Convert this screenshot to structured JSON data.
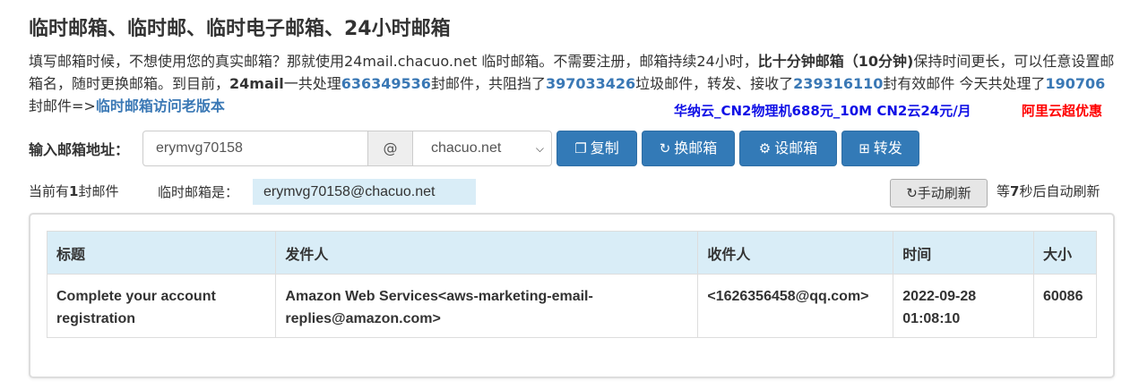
{
  "page_title": "临时邮箱、临时邮、临时电子邮箱、24小时邮箱",
  "intro": {
    "p1": "填写邮箱时候，不想使用您的真实邮箱？那就使用24mail.chacuo.net 临时邮箱。不需要注册，邮箱持续24小时，",
    "bold1": "比十分钟邮箱（10分钟)",
    "p2": "保持时间更长，可以任意设置邮箱名，随时更换邮箱。到目前，",
    "bold2": "24mail",
    "p3": "一共处理",
    "n1": "636349536",
    "p4": "封邮件，共阻挡了",
    "n2": "397033426",
    "p5": "垃圾邮件，转发、接收了",
    "n3": "239316110",
    "p6": "封有效邮件 今天共处理了",
    "n4": "190706",
    "p7": "封邮件=>",
    "old_link": "临时邮箱访问老版本"
  },
  "ads": {
    "ad1": "华纳云_CN2物理机688元_10M CN2云24元/月",
    "ad2": "阿里云超优惠"
  },
  "form": {
    "label": "输入邮箱地址：",
    "mailbox_value": "erymvg70158",
    "at": "@",
    "domain_selected": "chacuo.net",
    "buttons": {
      "copy": "复制",
      "change": "换邮箱",
      "set": "设邮箱",
      "forward": "转发"
    }
  },
  "status": {
    "count_prefix": "当前有",
    "count": "1",
    "count_suffix": "封邮件",
    "current_label": "临时邮箱是：",
    "current_value": "erymvg70158@chacuo.net",
    "refresh_button": "手动刷新",
    "auto_prefix": "等",
    "auto_seconds": "7",
    "auto_suffix": "秒后自动刷新"
  },
  "table": {
    "headers": [
      "标题",
      "发件人",
      "收件人",
      "时间",
      "大小"
    ],
    "rows": [
      {
        "subject": "Complete your account registration",
        "sender": "Amazon Web Services<aws-marketing-email-replies@amazon.com>",
        "recipient": "<1626356458@qq.com>",
        "time": "2022-09-28 01:08:10",
        "size": "60086"
      }
    ]
  },
  "colors": {
    "primary": "#337ab7",
    "info_bg": "#d9edf7",
    "link": "#3a78b5",
    "ad_blue": "#1010e6",
    "ad_red": "#ff0000"
  }
}
